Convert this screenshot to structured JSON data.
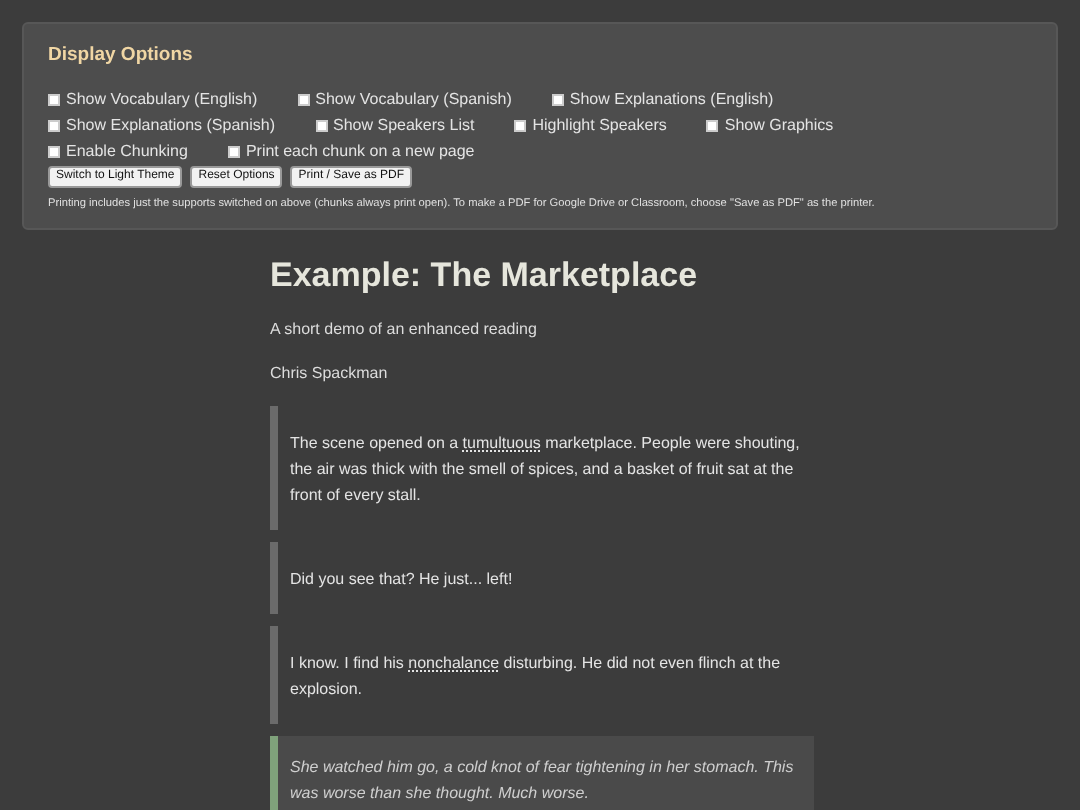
{
  "options_panel": {
    "title": "Display Options",
    "checkbox_rows": [
      [
        {
          "label": "Show Vocabulary (English)",
          "checked": false
        },
        {
          "label": "Show Vocabulary (Spanish)",
          "checked": false
        },
        {
          "label": "Show Explanations (English)",
          "checked": false
        }
      ],
      [
        {
          "label": "Show Explanations (Spanish)",
          "checked": false
        },
        {
          "label": "Show Speakers List",
          "checked": false
        },
        {
          "label": "Highlight Speakers",
          "checked": false
        },
        {
          "label": "Show Graphics",
          "checked": false
        }
      ],
      [
        {
          "label": "Enable Chunking",
          "checked": false
        },
        {
          "label": "Print each chunk on a new page",
          "checked": false
        }
      ]
    ],
    "buttons": [
      "Switch to Light Theme",
      "Reset Options",
      "Print / Save as PDF"
    ],
    "note": "Printing includes just the supports switched on above (chunks always print open). To make a PDF for Google Drive or Classroom, choose \"Save as PDF\" as the printer."
  },
  "reading": {
    "title": "Example: The Marketplace",
    "subtitle": "A short demo of an enhanced reading",
    "author": "Chris Spackman",
    "passages": [
      {
        "kind": "dialogue",
        "segments": [
          {
            "text": "The scene opened on a ",
            "vocab": false
          },
          {
            "text": "tumultuous",
            "vocab": true
          },
          {
            "text": " marketplace. People were shouting, the air was thick with the smell of spices, and a basket of fruit sat at the front of every stall.",
            "vocab": false
          }
        ]
      },
      {
        "kind": "dialogue",
        "segments": [
          {
            "text": "Did you see that? He just... left!",
            "vocab": false
          }
        ]
      },
      {
        "kind": "dialogue",
        "segments": [
          {
            "text": "I know. I find his ",
            "vocab": false
          },
          {
            "text": "nonchalance",
            "vocab": true
          },
          {
            "text": " disturbing. He did not even flinch at the explosion.",
            "vocab": false
          }
        ]
      },
      {
        "kind": "narration",
        "segments": [
          {
            "text": "She watched him go, a cold knot of fear tightening in her stomach. This was worse than she thought. Much worse.",
            "vocab": false
          }
        ]
      }
    ]
  }
}
